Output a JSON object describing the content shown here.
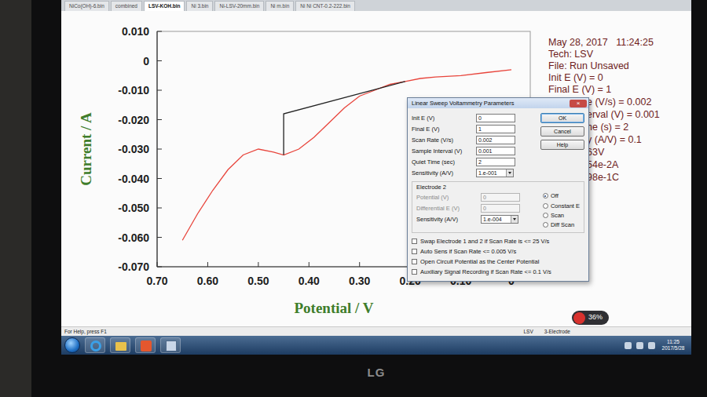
{
  "window": {
    "tabs": [
      {
        "label": "NiCo(OH)-6.bin",
        "selected": false
      },
      {
        "label": "combined",
        "selected": false
      },
      {
        "label": "LSV-KOH.bin",
        "selected": true
      },
      {
        "label": "Ni 3.bin",
        "selected": false
      },
      {
        "label": "Ni-LSV-20mm.bin",
        "selected": false
      },
      {
        "label": "Ni m.bin",
        "selected": false
      },
      {
        "label": "Ni Ni CNT-0.2-222.bin",
        "selected": false
      }
    ]
  },
  "chart": {
    "y_axis_title": "Current / A",
    "x_axis_title": "Potential / V",
    "y_ticks": [
      "0.010",
      "0",
      "-0.010",
      "-0.020",
      "-0.030",
      "-0.040",
      "-0.050",
      "-0.060",
      "-0.070"
    ],
    "x_ticks": [
      "0.70",
      "0.60",
      "0.50",
      "0.40",
      "0.30",
      "0.20",
      "0.10",
      "0"
    ],
    "series": [
      {
        "color": "#e8453c",
        "x": [
          0.65,
          0.62,
          0.59,
          0.56,
          0.53,
          0.5,
          0.47,
          0.45,
          0.42,
          0.39,
          0.36,
          0.33,
          0.3,
          0.27,
          0.24,
          0.21,
          0.18,
          0.15,
          0.1,
          0.05,
          0.0
        ],
        "y": [
          -0.061,
          -0.052,
          -0.044,
          -0.037,
          -0.032,
          -0.03,
          -0.031,
          -0.032,
          -0.03,
          -0.026,
          -0.021,
          -0.016,
          -0.012,
          -0.01,
          -0.008,
          -0.007,
          -0.006,
          -0.0055,
          -0.005,
          -0.004,
          -0.003
        ]
      },
      {
        "color": "#222222",
        "x": [
          0.45,
          0.45,
          0.21
        ],
        "y": [
          -0.032,
          -0.018,
          -0.007
        ]
      }
    ]
  },
  "info": {
    "lines": [
      "May 28, 2017   11:24:25",
      "Tech: LSV",
      "File: Run Unsaved",
      "Init E (V) = 0",
      "Final E (V) = 1"
    ],
    "cut_lines": [
      "e (V/s) = 0.002",
      "erval (V) = 0.001",
      "he (s) = 2",
      "y (A/V) = 0.1",
      "63V",
      "54e-2A",
      "98e-1C"
    ]
  },
  "dialog": {
    "title": "Linear Sweep Voltammetry Parameters",
    "close": "×",
    "fields": [
      {
        "label": "Init E (V)",
        "value": "0",
        "kind": "text"
      },
      {
        "label": "Final E (V)",
        "value": "1",
        "kind": "text"
      },
      {
        "label": "Scan Rate (V/s)",
        "value": "0.002",
        "kind": "text"
      },
      {
        "label": "Sample Interval (V)",
        "value": "0.001",
        "kind": "text"
      },
      {
        "label": "Quiet Time (sec)",
        "value": "2",
        "kind": "text"
      },
      {
        "label": "Sensitivity (A/V)",
        "value": "1.e-001",
        "kind": "select"
      }
    ],
    "buttons": [
      {
        "label": "OK",
        "default": true
      },
      {
        "label": "Cancel",
        "default": false
      },
      {
        "label": "Help",
        "default": false
      }
    ],
    "electrode2": {
      "title": "Electrode 2",
      "fields": [
        {
          "label": "Potential (V)",
          "value": "0",
          "kind": "text",
          "disabled": true
        },
        {
          "label": "Differential E (V)",
          "value": "0",
          "kind": "text",
          "disabled": true
        },
        {
          "label": "Sensitivity (A/V)",
          "value": "1.e-004",
          "kind": "select",
          "disabled": false
        }
      ],
      "modes": [
        {
          "label": "Off",
          "selected": true
        },
        {
          "label": "Constant E",
          "selected": false
        },
        {
          "label": "Scan",
          "selected": false
        },
        {
          "label": "Diff Scan",
          "selected": false
        }
      ]
    },
    "options": [
      {
        "label": "Swap Electrode 1 and 2 if Scan Rate is <= 25 V/s",
        "checked": false
      },
      {
        "label": "Auto Sens if Scan Rate <= 0.005 V/s",
        "checked": false
      },
      {
        "label": "Open Circuit Potential as the Center Potential",
        "checked": false
      },
      {
        "label": "Auxiliary Signal Recording if Scan Rate <= 0.1 V/s",
        "checked": false
      }
    ]
  },
  "overlay": {
    "reading": "36%"
  },
  "status_bar": {
    "help": "For Help, press F1",
    "mode": "LSV",
    "electrode": "3-Electrode"
  },
  "taskbar": {
    "time": "11:25",
    "date": "2017/5/28"
  },
  "bezel": {
    "brand": "LG"
  }
}
